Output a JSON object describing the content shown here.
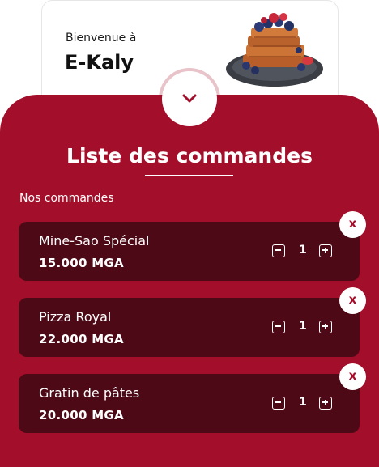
{
  "header": {
    "welcome": "Bienvenue à",
    "app_name": "E-Kaly",
    "hero_image": "waffles-with-berries-image",
    "toggle_icon": "chevron-down-icon"
  },
  "main": {
    "title": "Liste des commandes",
    "subtitle": "Nos commandes",
    "orders": [
      {
        "name": "Mine-Sao Spécial",
        "price": "15.000 MGA",
        "quantity": "1",
        "remove_label": "x"
      },
      {
        "name": "Pizza Royal",
        "price": "22.000 MGA",
        "quantity": "1",
        "remove_label": "x"
      },
      {
        "name": "Gratin de pâtes",
        "price": "20.000 MGA",
        "quantity": "1",
        "remove_label": "x"
      }
    ]
  },
  "colors": {
    "primary": "#a30f2b",
    "card_dark": "#4d0a16",
    "white": "#ffffff"
  }
}
